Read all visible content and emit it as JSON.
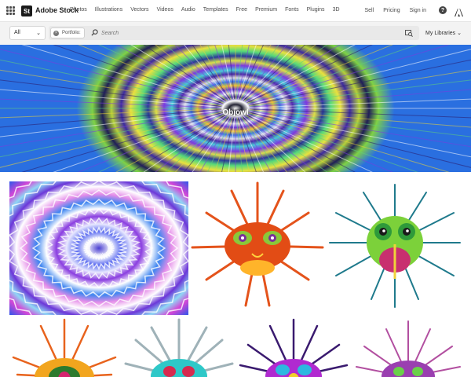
{
  "nav": {
    "brand_badge": "St",
    "brand": "Adobe Stock",
    "links": [
      "Photos",
      "Illustrations",
      "Vectors",
      "Videos",
      "Audio",
      "Templates",
      "Free",
      "Premium",
      "Fonts",
      "Plugins",
      "3D"
    ],
    "sell": "Sell",
    "pricing": "Pricing",
    "signin": "Sign in",
    "help": "?"
  },
  "search": {
    "scope": "All",
    "chip": "Portfolio:",
    "placeholder": "Search",
    "my_libraries": "My Libraries"
  },
  "hero": {
    "title": "Objowl"
  },
  "colors": {
    "text": "#2c2c2c",
    "search_bg": "#f3f3f3"
  }
}
